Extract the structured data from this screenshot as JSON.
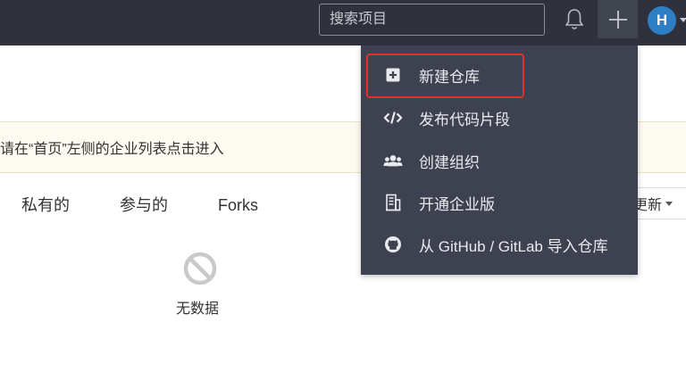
{
  "topbar": {
    "search_placeholder": "搜索项目",
    "avatar_initial": "H"
  },
  "notice": {
    "text": "请在“首页”左侧的企业列表点击进入"
  },
  "tabs": [
    {
      "label": "私有的"
    },
    {
      "label": "参与的"
    },
    {
      "label": "Forks"
    }
  ],
  "sort": {
    "label": "更新"
  },
  "empty": {
    "text": "无数据"
  },
  "menu": {
    "items": [
      {
        "label": "新建仓库",
        "icon": "plus-square-icon"
      },
      {
        "label": "发布代码片段",
        "icon": "code-icon"
      },
      {
        "label": "创建组织",
        "icon": "users-icon"
      },
      {
        "label": "开通企业版",
        "icon": "building-icon"
      },
      {
        "label": "从 GitHub / GitLab 导入仓库",
        "icon": "github-icon"
      }
    ]
  },
  "colors": {
    "topbar_bg": "#2f323d",
    "menu_bg": "#3e4250",
    "avatar_bg": "#2e7ec6",
    "highlight": "#e5302a"
  }
}
